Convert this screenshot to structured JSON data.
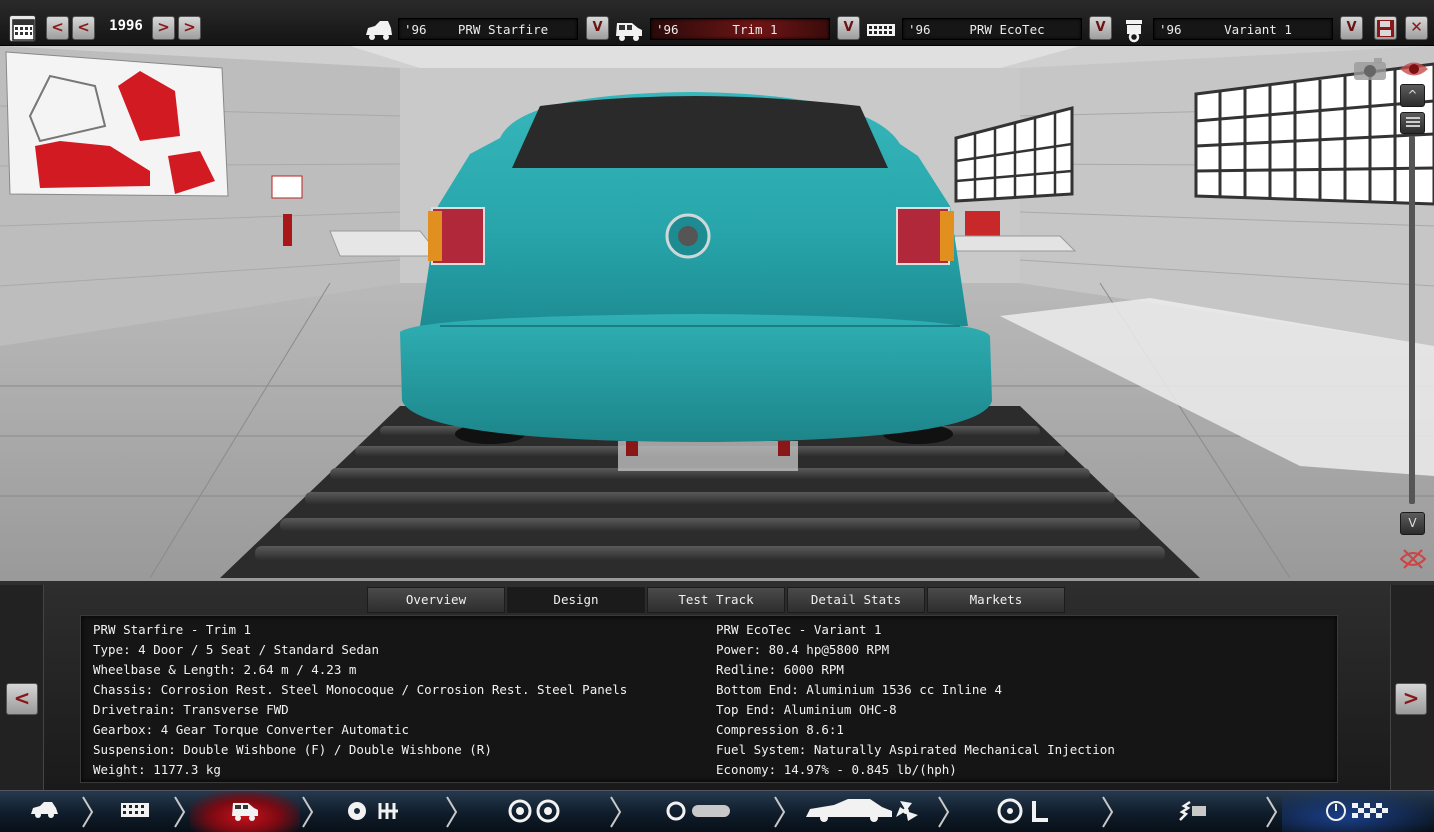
{
  "topbar": {
    "year": "1996",
    "prev_label": "<",
    "next_label": ">",
    "dropdown_label": "V",
    "save_icon": "save-icon",
    "close_label": "✕",
    "fields": [
      {
        "year": "'96",
        "name": "PRW Starfire",
        "icon": "car-body-icon"
      },
      {
        "year": "'96",
        "name": "Trim 1",
        "icon": "car-trim-icon"
      },
      {
        "year": "'96",
        "name": "PRW EcoTec",
        "icon": "engine-icon"
      },
      {
        "year": "'96",
        "name": "Variant 1",
        "icon": "piston-icon"
      }
    ]
  },
  "viewport": {
    "camera_icon": "camera-icon",
    "eye_icon": "eye-icon",
    "scroll_up_label": "^",
    "scroll_down_label": "V"
  },
  "panel": {
    "tabs": [
      {
        "label": "Overview"
      },
      {
        "label": "Design",
        "active": true
      },
      {
        "label": "Test Track"
      },
      {
        "label": "Detail Stats"
      },
      {
        "label": "Markets"
      }
    ],
    "left_stats": [
      "PRW Starfire - Trim 1",
      "Type: 4 Door / 5 Seat / Standard Sedan",
      "Wheelbase & Length: 2.64 m / 4.23 m",
      "Chassis: Corrosion Rest. Steel Monocoque / Corrosion Rest. Steel Panels",
      "Drivetrain: Transverse FWD",
      "Gearbox: 4 Gear Torque Converter Automatic",
      "Suspension: Double Wishbone (F) / Double Wishbone (R)",
      "Weight: 1177.3 kg"
    ],
    "right_stats": [
      "PRW EcoTec - Variant 1",
      "Power: 80.4 hp@5800 RPM",
      "Redline: 6000 RPM",
      "Bottom End: Aluminium 1536 cc Inline 4",
      "Top End: Aluminium OHC-8",
      "Compression 8.6:1",
      "Fuel System: Naturally Aspirated Mechanical Injection",
      "Economy: 14.97% - 0.845 lb/(hph)"
    ],
    "prev_label": "<",
    "next_label": ">"
  },
  "bottom_nav": [
    {
      "icon": "car-body-icon"
    },
    {
      "icon": "chassis-icon"
    },
    {
      "icon": "car-trim-icon",
      "active": true
    },
    {
      "icon": "drivetrain-icon"
    },
    {
      "icon": "wheels-icon"
    },
    {
      "icon": "body-design-icon"
    },
    {
      "icon": "interior-icon"
    },
    {
      "icon": "suspension-icon"
    },
    {
      "icon": "test-icon"
    }
  ],
  "colors": {
    "car": "#2aa8ad",
    "accent_red": "#8a1717",
    "nav_active": "#c8101c"
  }
}
